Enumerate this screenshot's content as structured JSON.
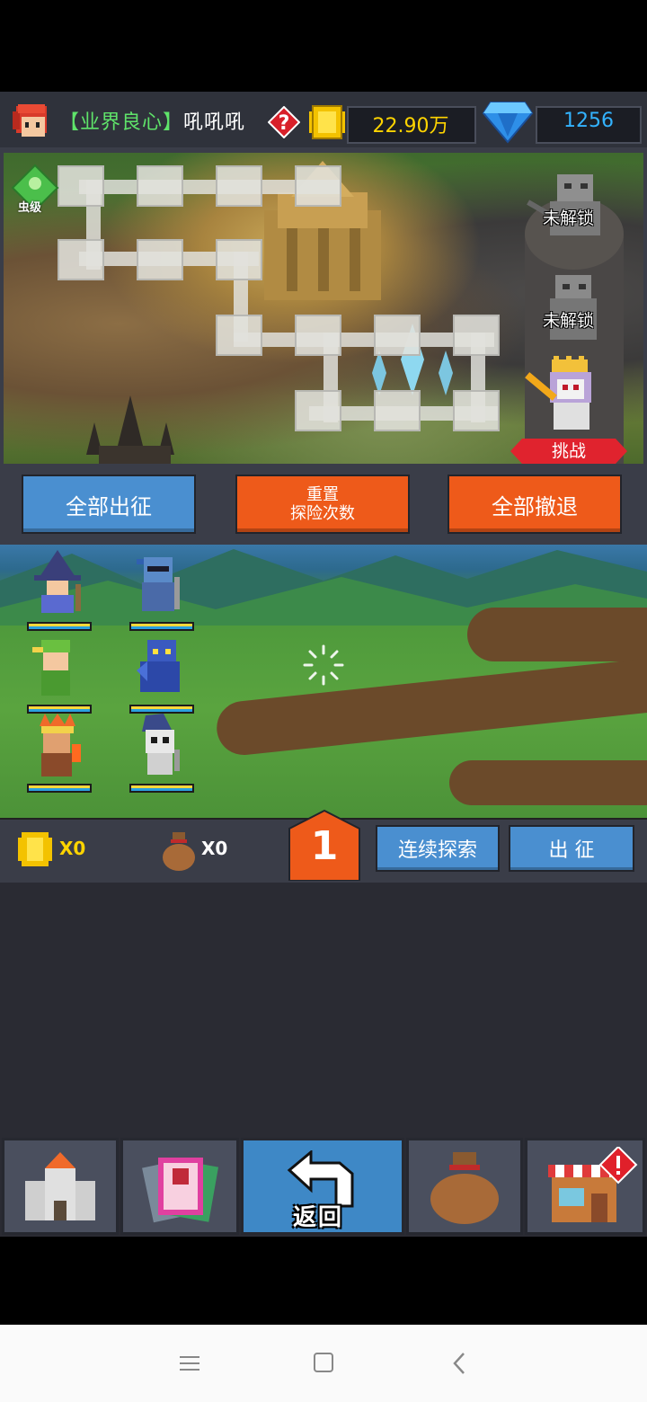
{
  "header": {
    "player_tag": "【业界良心】",
    "player_name": "吼吼吼",
    "coins": "22.90万",
    "gems": "1256",
    "icons": [
      "avatar-icon",
      "help-icon",
      "coin-icon",
      "gem-icon"
    ]
  },
  "map": {
    "rank_label": "虫级",
    "boss_slots": [
      {
        "label": "未解锁"
      },
      {
        "label": "未解锁"
      }
    ],
    "challenge_label": "挑战"
  },
  "actions": {
    "deploy_all": "全部出征",
    "reset_line1": "重置",
    "reset_line2": "探险次数",
    "retreat_all": "全部撤退"
  },
  "loot": {
    "coins": "X0",
    "bags": "X0",
    "wave": "1",
    "continuous_label": "连续探索",
    "deploy_label": "出 征"
  },
  "nav": {
    "back_label": "返回",
    "items": [
      "castle-icon",
      "cards-icon",
      "back-icon",
      "bag-icon",
      "shop-icon"
    ]
  },
  "colors": {
    "button_blue": "#4a8fd0",
    "button_orange": "#ee5a1a",
    "gold": "#ffd400",
    "gem": "#33b3ff",
    "panel": "#3a3d48"
  }
}
